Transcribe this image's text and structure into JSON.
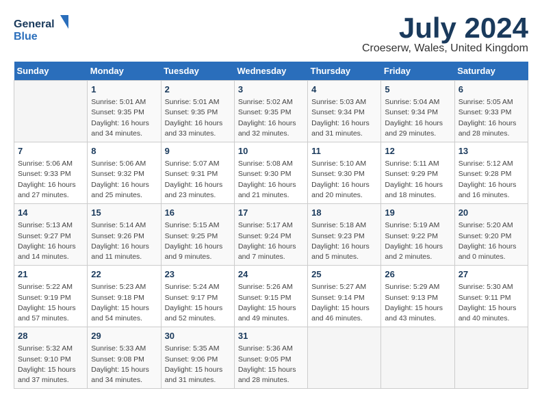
{
  "logo": {
    "line1": "General",
    "line2": "Blue"
  },
  "title": {
    "month_year": "July 2024",
    "location": "Croeserw, Wales, United Kingdom"
  },
  "days_of_week": [
    "Sunday",
    "Monday",
    "Tuesday",
    "Wednesday",
    "Thursday",
    "Friday",
    "Saturday"
  ],
  "weeks": [
    [
      {
        "day": "",
        "info": ""
      },
      {
        "day": "1",
        "info": "Sunrise: 5:01 AM\nSunset: 9:35 PM\nDaylight: 16 hours\nand 34 minutes."
      },
      {
        "day": "2",
        "info": "Sunrise: 5:01 AM\nSunset: 9:35 PM\nDaylight: 16 hours\nand 33 minutes."
      },
      {
        "day": "3",
        "info": "Sunrise: 5:02 AM\nSunset: 9:35 PM\nDaylight: 16 hours\nand 32 minutes."
      },
      {
        "day": "4",
        "info": "Sunrise: 5:03 AM\nSunset: 9:34 PM\nDaylight: 16 hours\nand 31 minutes."
      },
      {
        "day": "5",
        "info": "Sunrise: 5:04 AM\nSunset: 9:34 PM\nDaylight: 16 hours\nand 29 minutes."
      },
      {
        "day": "6",
        "info": "Sunrise: 5:05 AM\nSunset: 9:33 PM\nDaylight: 16 hours\nand 28 minutes."
      }
    ],
    [
      {
        "day": "7",
        "info": "Sunrise: 5:06 AM\nSunset: 9:33 PM\nDaylight: 16 hours\nand 27 minutes."
      },
      {
        "day": "8",
        "info": "Sunrise: 5:06 AM\nSunset: 9:32 PM\nDaylight: 16 hours\nand 25 minutes."
      },
      {
        "day": "9",
        "info": "Sunrise: 5:07 AM\nSunset: 9:31 PM\nDaylight: 16 hours\nand 23 minutes."
      },
      {
        "day": "10",
        "info": "Sunrise: 5:08 AM\nSunset: 9:30 PM\nDaylight: 16 hours\nand 21 minutes."
      },
      {
        "day": "11",
        "info": "Sunrise: 5:10 AM\nSunset: 9:30 PM\nDaylight: 16 hours\nand 20 minutes."
      },
      {
        "day": "12",
        "info": "Sunrise: 5:11 AM\nSunset: 9:29 PM\nDaylight: 16 hours\nand 18 minutes."
      },
      {
        "day": "13",
        "info": "Sunrise: 5:12 AM\nSunset: 9:28 PM\nDaylight: 16 hours\nand 16 minutes."
      }
    ],
    [
      {
        "day": "14",
        "info": "Sunrise: 5:13 AM\nSunset: 9:27 PM\nDaylight: 16 hours\nand 14 minutes."
      },
      {
        "day": "15",
        "info": "Sunrise: 5:14 AM\nSunset: 9:26 PM\nDaylight: 16 hours\nand 11 minutes."
      },
      {
        "day": "16",
        "info": "Sunrise: 5:15 AM\nSunset: 9:25 PM\nDaylight: 16 hours\nand 9 minutes."
      },
      {
        "day": "17",
        "info": "Sunrise: 5:17 AM\nSunset: 9:24 PM\nDaylight: 16 hours\nand 7 minutes."
      },
      {
        "day": "18",
        "info": "Sunrise: 5:18 AM\nSunset: 9:23 PM\nDaylight: 16 hours\nand 5 minutes."
      },
      {
        "day": "19",
        "info": "Sunrise: 5:19 AM\nSunset: 9:22 PM\nDaylight: 16 hours\nand 2 minutes."
      },
      {
        "day": "20",
        "info": "Sunrise: 5:20 AM\nSunset: 9:20 PM\nDaylight: 16 hours\nand 0 minutes."
      }
    ],
    [
      {
        "day": "21",
        "info": "Sunrise: 5:22 AM\nSunset: 9:19 PM\nDaylight: 15 hours\nand 57 minutes."
      },
      {
        "day": "22",
        "info": "Sunrise: 5:23 AM\nSunset: 9:18 PM\nDaylight: 15 hours\nand 54 minutes."
      },
      {
        "day": "23",
        "info": "Sunrise: 5:24 AM\nSunset: 9:17 PM\nDaylight: 15 hours\nand 52 minutes."
      },
      {
        "day": "24",
        "info": "Sunrise: 5:26 AM\nSunset: 9:15 PM\nDaylight: 15 hours\nand 49 minutes."
      },
      {
        "day": "25",
        "info": "Sunrise: 5:27 AM\nSunset: 9:14 PM\nDaylight: 15 hours\nand 46 minutes."
      },
      {
        "day": "26",
        "info": "Sunrise: 5:29 AM\nSunset: 9:13 PM\nDaylight: 15 hours\nand 43 minutes."
      },
      {
        "day": "27",
        "info": "Sunrise: 5:30 AM\nSunset: 9:11 PM\nDaylight: 15 hours\nand 40 minutes."
      }
    ],
    [
      {
        "day": "28",
        "info": "Sunrise: 5:32 AM\nSunset: 9:10 PM\nDaylight: 15 hours\nand 37 minutes."
      },
      {
        "day": "29",
        "info": "Sunrise: 5:33 AM\nSunset: 9:08 PM\nDaylight: 15 hours\nand 34 minutes."
      },
      {
        "day": "30",
        "info": "Sunrise: 5:35 AM\nSunset: 9:06 PM\nDaylight: 15 hours\nand 31 minutes."
      },
      {
        "day": "31",
        "info": "Sunrise: 5:36 AM\nSunset: 9:05 PM\nDaylight: 15 hours\nand 28 minutes."
      },
      {
        "day": "",
        "info": ""
      },
      {
        "day": "",
        "info": ""
      },
      {
        "day": "",
        "info": ""
      }
    ]
  ]
}
